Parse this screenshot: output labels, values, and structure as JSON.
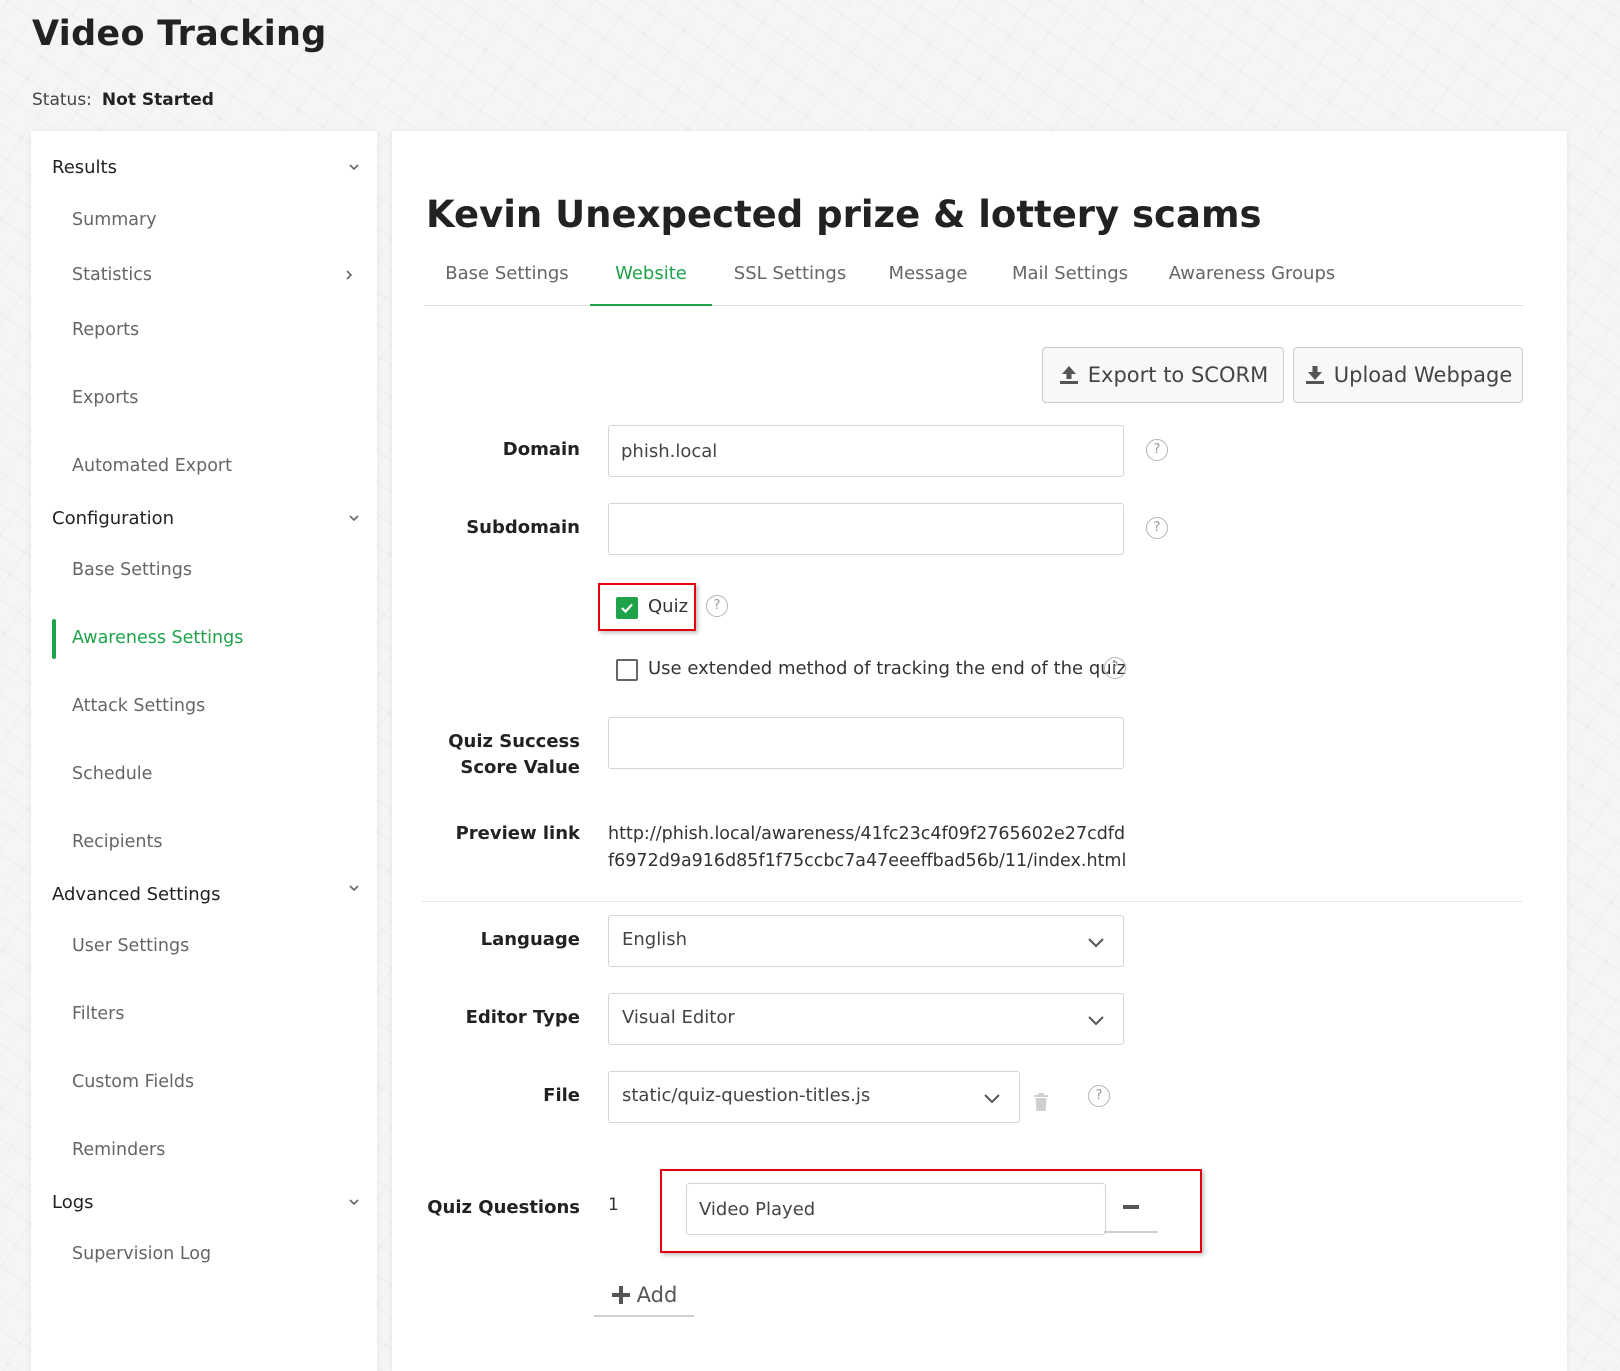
{
  "page": {
    "title": "Video Tracking"
  },
  "status": {
    "label": "Status:",
    "value": "Not Started"
  },
  "sidebar": {
    "sections": [
      {
        "label": "Results",
        "items": [
          "Summary",
          "Statistics",
          "Reports",
          "Exports",
          "Automated Export"
        ]
      },
      {
        "label": "Configuration",
        "items": [
          "Base Settings",
          "Awareness Settings",
          "Attack Settings",
          "Schedule",
          "Recipients"
        ]
      },
      {
        "label": "Advanced Settings",
        "items": [
          "User Settings",
          "Filters",
          "Custom Fields",
          "Reminders"
        ]
      },
      {
        "label": "Logs",
        "items": [
          "Supervision Log"
        ]
      }
    ],
    "active_item": "Awareness Settings"
  },
  "main": {
    "title": "Kevin Unexpected prize & lottery scams",
    "tabs": [
      "Base Settings",
      "Website",
      "SSL Settings",
      "Message",
      "Mail Settings",
      "Awareness Groups"
    ],
    "active_tab": "Website",
    "buttons": {
      "export_scorm": "Export to SCORM",
      "upload_webpage": "Upload Webpage"
    },
    "form": {
      "domain_label": "Domain",
      "domain_value": "phish.local",
      "subdomain_label": "Subdomain",
      "subdomain_value": "",
      "quiz_label": "Quiz",
      "quiz_checked": true,
      "extended_label": "Use extended method of tracking the end of the quiz",
      "extended_checked": false,
      "quiz_score_label_line1": "Quiz Success",
      "quiz_score_label_line2": "Score Value",
      "quiz_score_value": "",
      "preview_label": "Preview link",
      "preview_link": "http://phish.local/awareness/41fc23c4f09f2765602e27cdfdf6972d9a916d85f1f75ccbc7a47eeeffbad56b/11/index.html",
      "language_label": "Language",
      "language_value": "English",
      "editor_label": "Editor Type",
      "editor_value": "Visual Editor",
      "file_label": "File",
      "file_value": "static/quiz-question-titles.js",
      "quiz_questions_label": "Quiz Questions",
      "question_number": "1",
      "question_value": "Video Played",
      "add_label": "Add",
      "help_symbol": "?"
    }
  },
  "colors": {
    "accent": "#1fa34a",
    "highlight": "#e0000e"
  }
}
